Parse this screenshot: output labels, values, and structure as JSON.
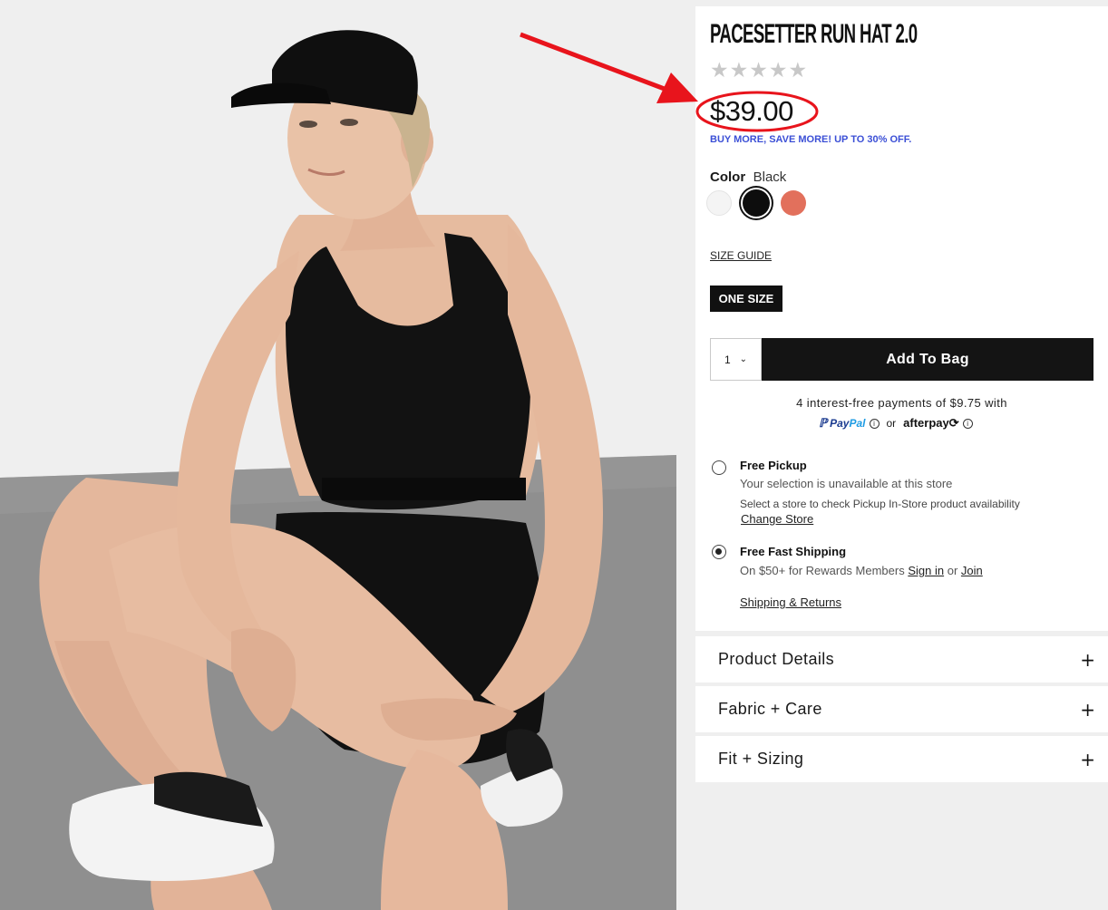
{
  "product": {
    "title": "PACESETTER RUN HAT 2.0",
    "rating_stars": [
      "★",
      "★",
      "★",
      "★",
      "★"
    ],
    "price": "$39.00",
    "promo": "BUY MORE, SAVE MORE! UP TO 30% OFF."
  },
  "color": {
    "label": "Color",
    "selected": "Black",
    "swatches": [
      {
        "name": "White",
        "hex": "#f4f4f4"
      },
      {
        "name": "Black",
        "hex": "#0d0d0d"
      },
      {
        "name": "Coral",
        "hex": "#e2705c"
      }
    ]
  },
  "size": {
    "guide_label": "SIZE GUIDE",
    "selected": "ONE SIZE"
  },
  "cart": {
    "quantity": "1",
    "add_label": "Add To Bag"
  },
  "payments": {
    "line": "4 interest-free payments of $9.75 with",
    "paypal_a": "Pay",
    "paypal_b": "Pal",
    "or": "or",
    "afterpay": "afterpay",
    "info_glyph": "i"
  },
  "fulfillment": {
    "pickup_title": "Free Pickup",
    "pickup_status": "Your selection is unavailable at this store",
    "pickup_hint": "Select a store to check Pickup In-Store product availability",
    "change_store": "Change Store",
    "shipping_title": "Free Fast Shipping",
    "shipping_text": "On $50+ for Rewards Members",
    "sign_in": "Sign in",
    "or": "or",
    "join": "Join",
    "returns_link": "Shipping & Returns"
  },
  "accordions": [
    {
      "label": "Product Details",
      "icon": "+"
    },
    {
      "label": "Fabric + Care",
      "icon": "+"
    },
    {
      "label": "Fit + Sizing",
      "icon": "+"
    }
  ],
  "colors": {
    "annotation_red": "#e8141c",
    "promo_blue": "#3b4fd6",
    "button_black": "#141414"
  }
}
